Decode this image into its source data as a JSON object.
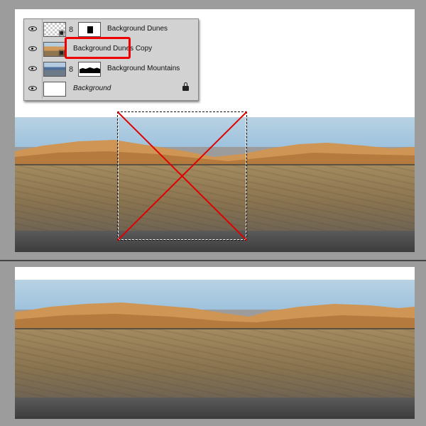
{
  "layers_panel": {
    "layers": [
      {
        "name": "Background Dunes",
        "visible": true,
        "has_mask": true,
        "selected": true
      },
      {
        "name": "Background Dunes Copy",
        "visible": true,
        "has_mask": false,
        "selected": false
      },
      {
        "name": "Background Mountains",
        "visible": true,
        "has_mask": true,
        "selected": false
      },
      {
        "name": "Background",
        "visible": true,
        "has_mask": false,
        "locked": true,
        "italic": true
      }
    ]
  },
  "colors": {
    "highlight": "#e00000",
    "x_mark": "#e00000",
    "workspace": "#9c9c9c",
    "canvas": "#ffffff"
  },
  "icons": {
    "visibility": "eye-icon",
    "link": "chain-link-icon",
    "lock": "lock-icon",
    "smart_object": "document-icon"
  }
}
